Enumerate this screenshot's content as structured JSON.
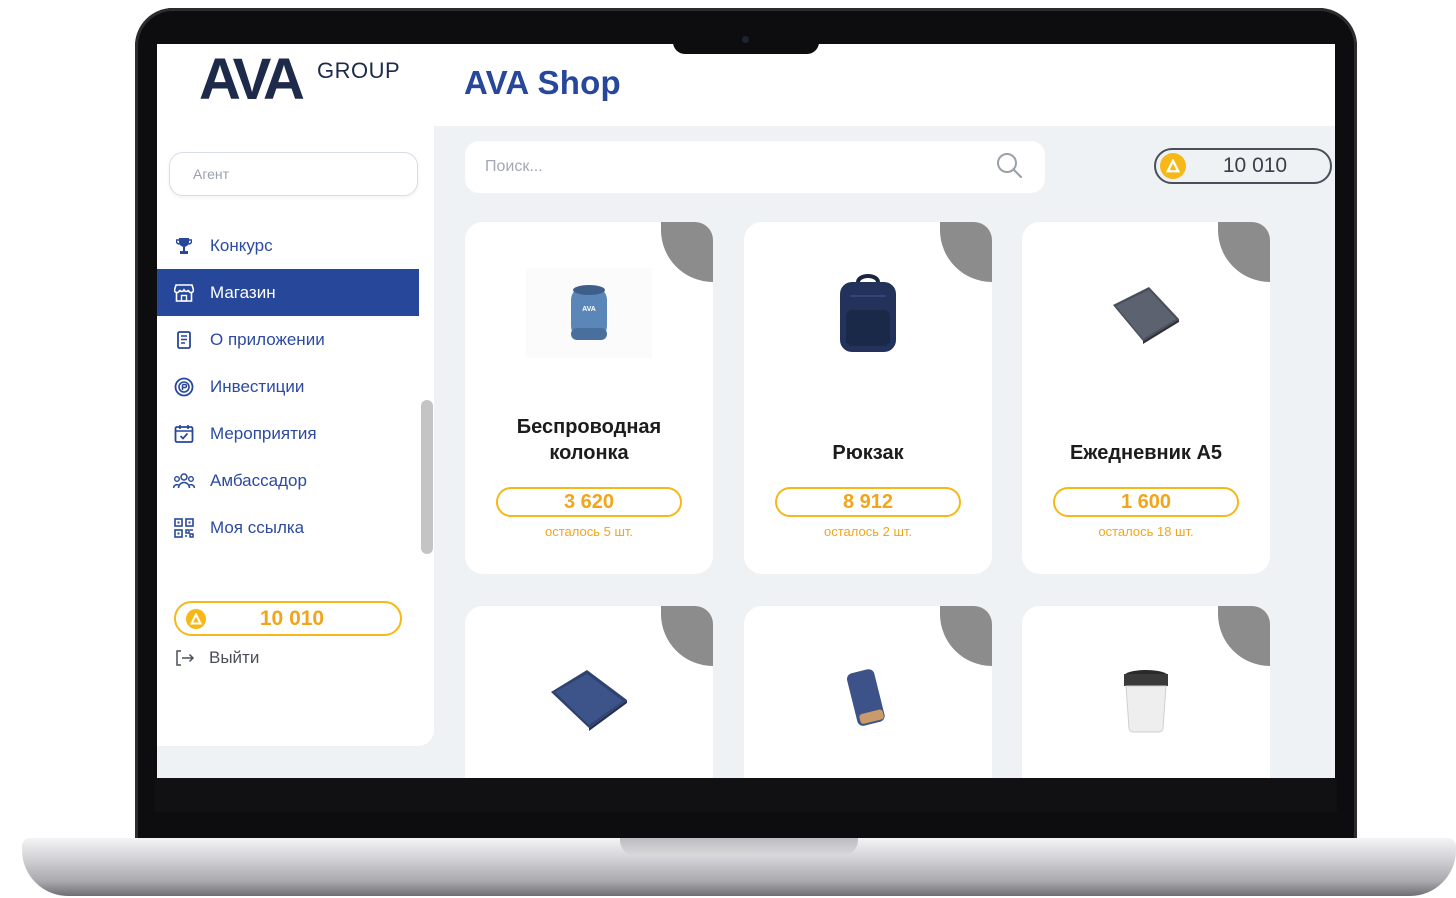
{
  "brand": {
    "logo_main": "AVA",
    "logo_sub": "GROUP"
  },
  "sidebar": {
    "agent_placeholder": "Агент",
    "items": [
      {
        "label": "Конкурс",
        "icon": "trophy-icon"
      },
      {
        "label": "Магазин",
        "icon": "store-icon",
        "active": true
      },
      {
        "label": "О приложении",
        "icon": "document-icon"
      },
      {
        "label": "Инвестиции",
        "icon": "investment-icon"
      },
      {
        "label": "Мероприятия",
        "icon": "calendar-icon"
      },
      {
        "label": "Амбассадор",
        "icon": "people-icon"
      },
      {
        "label": "Моя ссылка",
        "icon": "qr-code-icon"
      }
    ],
    "balance": "10 010",
    "logout_label": "Выйти"
  },
  "header": {
    "title": "AVA Shop"
  },
  "search": {
    "placeholder": "Поиск..."
  },
  "balance_top": "10 010",
  "products": [
    {
      "name": "Беспроводная колонка",
      "price": "3 620",
      "stock": "осталось 5 шт.",
      "image": "speaker-image"
    },
    {
      "name": "Рюкзак",
      "price": "8 912",
      "stock": "осталось 2 шт.",
      "image": "backpack-image"
    },
    {
      "name": "Ежедневник А5",
      "price": "1 600",
      "stock": "осталось 18 шт.",
      "image": "notebook-image"
    },
    {
      "name": "",
      "image": "notebook-blue-image"
    },
    {
      "name": "",
      "image": "powerbank-image"
    },
    {
      "name": "",
      "image": "thermo-cup-image"
    }
  ],
  "colors": {
    "accent": "#27479a",
    "coin": "#f5b817",
    "price": "#f2a51a",
    "background": "#eef2f5"
  }
}
